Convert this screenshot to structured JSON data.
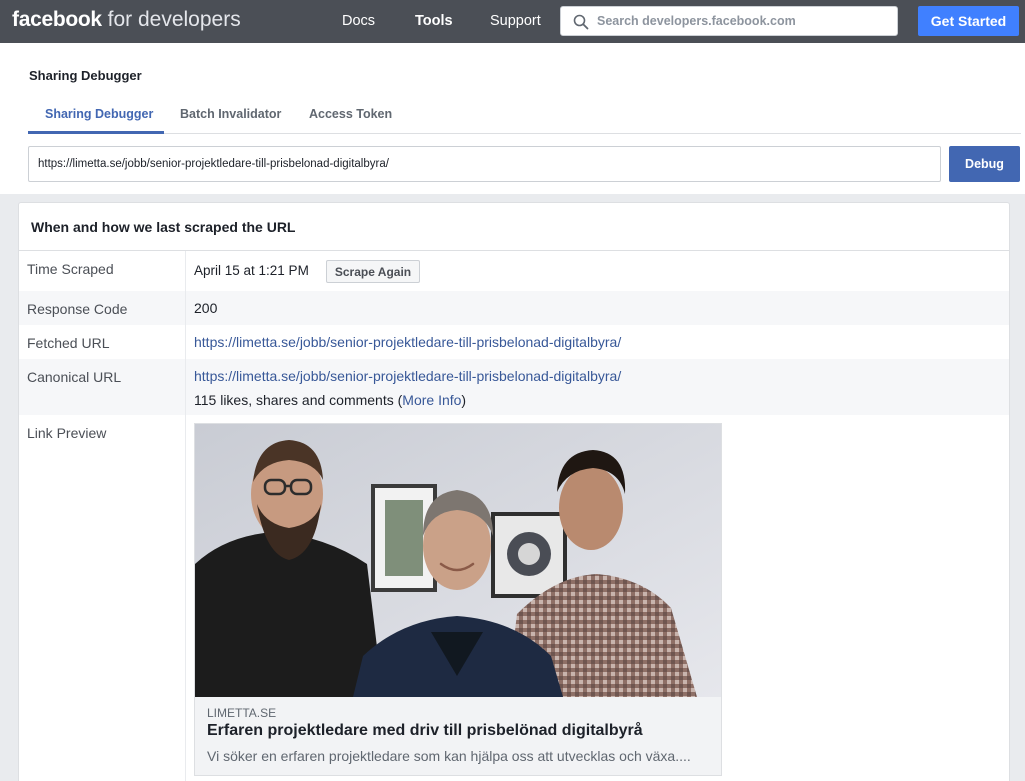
{
  "topbar": {
    "logo_brand": "facebook",
    "logo_suffix": " for developers",
    "nav": [
      {
        "label": "Docs"
      },
      {
        "label": "Tools"
      },
      {
        "label": "Support"
      }
    ],
    "search_placeholder": "Search developers.facebook.com",
    "search_icon": "search-icon",
    "get_started_label": "Get Started"
  },
  "header": {
    "title": "Sharing Debugger",
    "tabs": [
      {
        "label": "Sharing Debugger",
        "active": true
      },
      {
        "label": "Batch Invalidator",
        "active": false
      },
      {
        "label": "Access Token",
        "active": false
      }
    ],
    "url_value": "https://limetta.se/jobb/senior-projektledare-till-prisbelonad-digitalbyra/",
    "debug_label": "Debug"
  },
  "card": {
    "title": "When and how we last scraped the URL",
    "time_scraped": {
      "label": "Time Scraped",
      "value": "April 15 at 1:21 PM",
      "button": "Scrape Again"
    },
    "response_code": {
      "label": "Response Code",
      "value": "200"
    },
    "fetched_url": {
      "label": "Fetched URL",
      "value": "https://limetta.se/jobb/senior-projektledare-till-prisbelonad-digitalbyra/"
    },
    "canonical_url": {
      "label": "Canonical URL",
      "value": "https://limetta.se/jobb/senior-projektledare-till-prisbelonad-digitalbyra/",
      "engagement_text": "115 likes, shares and comments (",
      "more_info": "More Info",
      "engagement_close": ")"
    },
    "link_preview": {
      "label": "Link Preview",
      "domain": "LIMETTA.SE",
      "title": "Erfaren projektledare med driv till prisbelönad digitalbyrå",
      "description": "Vi söker en erfaren projektledare som kan hjälpa oss att utvecklas och växa...."
    }
  },
  "colors": {
    "topbar_bg": "#4b4f56",
    "primary": "#4267b2",
    "accent": "#4080ff",
    "link": "#385898",
    "page_bg": "#e9ebee"
  }
}
